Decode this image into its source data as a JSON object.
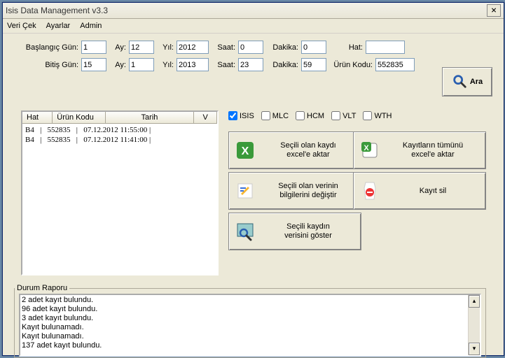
{
  "window": {
    "title": "Isis Data Management v3.3"
  },
  "menu": {
    "veri_cek": "Veri Çek",
    "ayarlar": "Ayarlar",
    "admin": "Admin"
  },
  "labels": {
    "baslangic_gun": "Başlangıç Gün:",
    "bitis_gun": "Bitiş Gün:",
    "ay": "Ay:",
    "yil": "Yıl:",
    "saat": "Saat:",
    "dakika": "Dakika:",
    "hat": "Hat:",
    "urun_kodu": "Ürün Kodu:"
  },
  "inputs": {
    "start_day": "1",
    "start_month": "12",
    "start_year": "2012",
    "start_hour": "0",
    "start_min": "0",
    "end_day": "15",
    "end_month": "1",
    "end_year": "2013",
    "end_hour": "23",
    "end_min": "59",
    "hat": "",
    "urun_kodu": "552835"
  },
  "search_button": "Ara",
  "list": {
    "headers": {
      "hat": "Hat",
      "urun_kodu": "Ürün Kodu",
      "tarih": "Tarih",
      "v": "V"
    },
    "rows": [
      "B4   |   552835   |   07.12.2012 11:55:00 |",
      "B4   |   552835   |   07.12.2012 11:41:00 |"
    ]
  },
  "checks": {
    "isis": "ISIS",
    "mlc": "MLC",
    "hcm": "HCM",
    "vlt": "VLT",
    "wth": "WTH"
  },
  "buttons": {
    "export_selected": "Seçili olan kaydı\nexcel'e aktar",
    "export_all": "Kayıtların tümünü\nexcel'e aktar",
    "edit_selected": "Seçili olan verinin\nbilgilerini değiştir",
    "delete": "Kayıt sil",
    "show_selected": "Seçili kaydın\nverisini göster"
  },
  "report": {
    "legend": "Durum Raporu",
    "text": "2 adet kayıt bulundu.\n96 adet kayıt bulundu.\n3 adet kayıt bulundu.\nKayıt bulunamadı.\nKayıt bulunamadı.\n137 adet kayıt bulundu."
  }
}
